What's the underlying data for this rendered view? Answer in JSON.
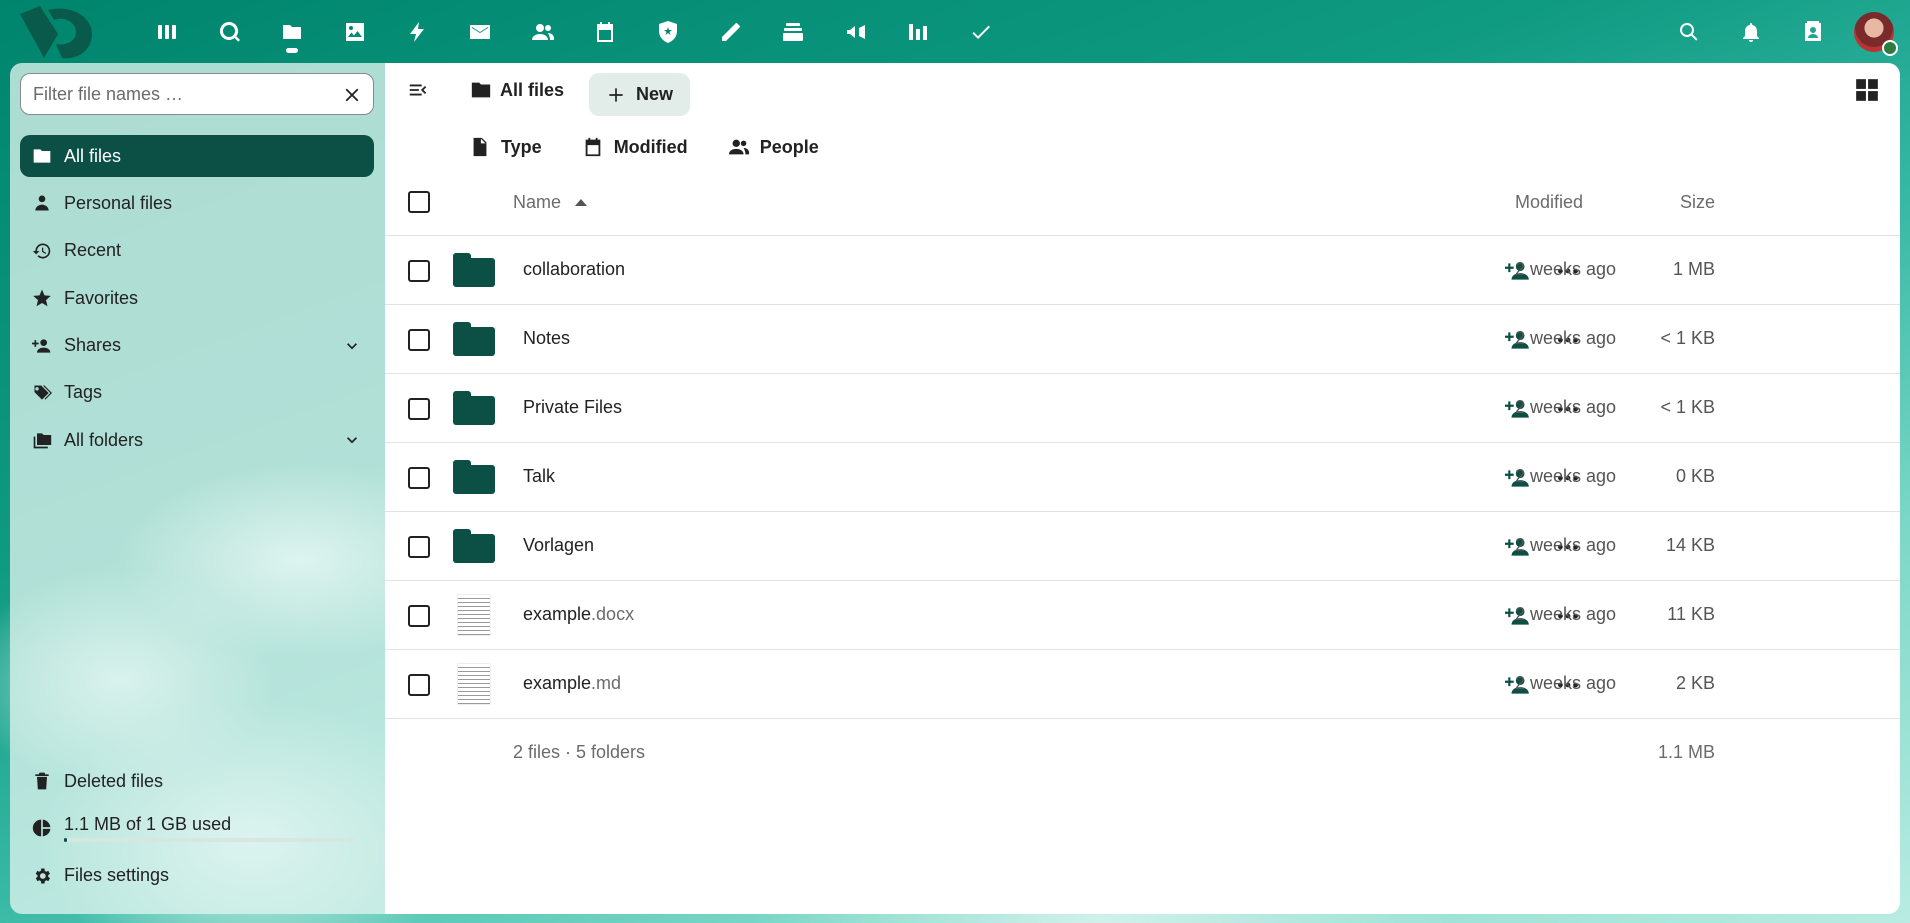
{
  "colors": {
    "header_bg": "#00856d",
    "primary": "#0c4f45",
    "sidebar_bg": "#def4ee",
    "new_button_bg": "#e2ece9"
  },
  "header": {
    "apps": [
      "dashboard",
      "search-circle",
      "files",
      "photos",
      "activity",
      "mail",
      "contacts",
      "calendar",
      "password-shield",
      "notes-pencil",
      "deck",
      "announcements",
      "analytics",
      "tasks"
    ],
    "right": [
      "search-icon",
      "notifications-icon",
      "contacts-menu-icon",
      "user-avatar"
    ]
  },
  "sidebar": {
    "filter_placeholder": "Filter file names …",
    "items": [
      {
        "label": "All files",
        "icon": "folder-icon",
        "active": true
      },
      {
        "label": "Personal files",
        "icon": "person-icon"
      },
      {
        "label": "Recent",
        "icon": "history-icon"
      },
      {
        "label": "Favorites",
        "icon": "star-icon"
      },
      {
        "label": "Shares",
        "icon": "share-person-icon",
        "expandable": true
      },
      {
        "label": "Tags",
        "icon": "tag-icon"
      },
      {
        "label": "All folders",
        "icon": "folders-icon",
        "expandable": true
      }
    ],
    "deleted": "Deleted files",
    "quota": "1.1 MB of 1 GB used",
    "quota_fraction": 0.0011,
    "settings": "Files settings"
  },
  "toolbar": {
    "breadcrumb": "All files",
    "new_label": "New",
    "filters": [
      "Type",
      "Modified",
      "People"
    ]
  },
  "table": {
    "headers": {
      "name": "Name",
      "size": "Size",
      "modified": "Modified"
    },
    "rows": [
      {
        "name": "collaboration",
        "ext": "",
        "kind": "folder",
        "size": "1 MB",
        "modified": "2 weeks ago"
      },
      {
        "name": "Notes",
        "ext": "",
        "kind": "folder",
        "size": "< 1 KB",
        "modified": "2 weeks ago"
      },
      {
        "name": "Private Files",
        "ext": "",
        "kind": "folder",
        "size": "< 1 KB",
        "modified": "2 weeks ago"
      },
      {
        "name": "Talk",
        "ext": "",
        "kind": "folder",
        "size": "0 KB",
        "modified": "2 weeks ago"
      },
      {
        "name": "Vorlagen",
        "ext": "",
        "kind": "folder",
        "size": "14 KB",
        "modified": "2 weeks ago"
      },
      {
        "name": "example",
        "ext": ".docx",
        "kind": "file",
        "size": "11 KB",
        "modified": "2 weeks ago"
      },
      {
        "name": "example",
        "ext": ".md",
        "kind": "file",
        "size": "2 KB",
        "modified": "2 weeks ago"
      }
    ],
    "summary": {
      "count": "2 files · 5 folders",
      "total": "1.1 MB"
    }
  }
}
